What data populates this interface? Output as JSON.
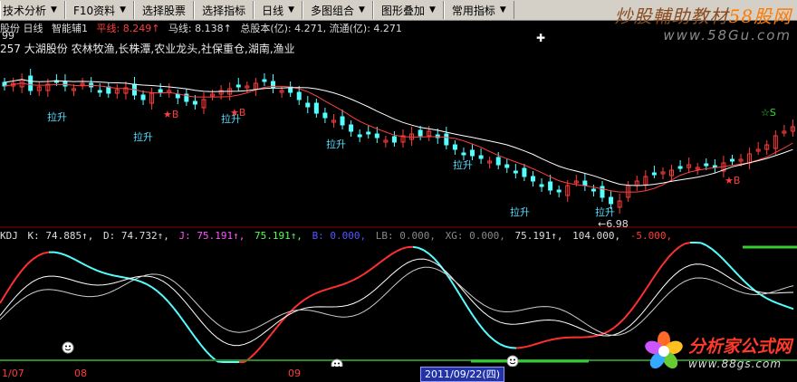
{
  "toolbar": {
    "items": [
      {
        "label": "技术分析",
        "arrow": "▼"
      },
      {
        "label": "F10资料",
        "arrow": "▼"
      },
      {
        "label": "选择股票",
        "arrow": ""
      },
      {
        "label": "选择指标",
        "arrow": ""
      },
      {
        "label": "日线",
        "arrow": "▼"
      },
      {
        "label": "多图组合",
        "arrow": "▼"
      },
      {
        "label": "图形叠加",
        "arrow": "▼"
      },
      {
        "label": "常用指标",
        "arrow": "▼"
      }
    ]
  },
  "watermark_top": {
    "title_a": "炒股輔助教材",
    "title_b": "58股网",
    "url": "www.58Gu.com"
  },
  "info1": {
    "stock": "股份 日线",
    "indicator": "智能辅1",
    "ping": "平线: 8.249↑",
    "ma": "马线: 8.138↑",
    "total": "总股本(亿): 4.271, 流通(亿): 4.271"
  },
  "info2": {
    "prefix": "257",
    "name": "大湖股份",
    "tags": "农林牧渔,长株潭,农业龙头,社保重仓,湖南,渔业"
  },
  "price_markers": {
    "top_value": "99",
    "low_value": "6.98",
    "lashang": "拉升",
    "buy": "B",
    "sell": "S"
  },
  "kdj": {
    "name": "KDJ",
    "k": "K: 74.885↑,",
    "d": "D: 74.732↑,",
    "j": "J: 75.191↑,",
    "v4": "75.191↑,",
    "b": "B: 0.000,",
    "lb": "LB: 0.000,",
    "xg": "XG: 0.000,",
    "v8": "75.191↑,",
    "v9": "104.000,",
    "v10": "-5.000,"
  },
  "dates": {
    "d1": "1/07",
    "d2": "08",
    "d3": "09",
    "cursor_date": "2011/09/22(四)"
  },
  "watermark_bottom": {
    "title": "分析家公式网",
    "url": "www.88gs.com"
  },
  "colors": {
    "up": "#ff3c3c",
    "down": "#55ffff",
    "kline": "#ff3030",
    "dline": "#ffffff",
    "green": "#33cc33"
  }
}
